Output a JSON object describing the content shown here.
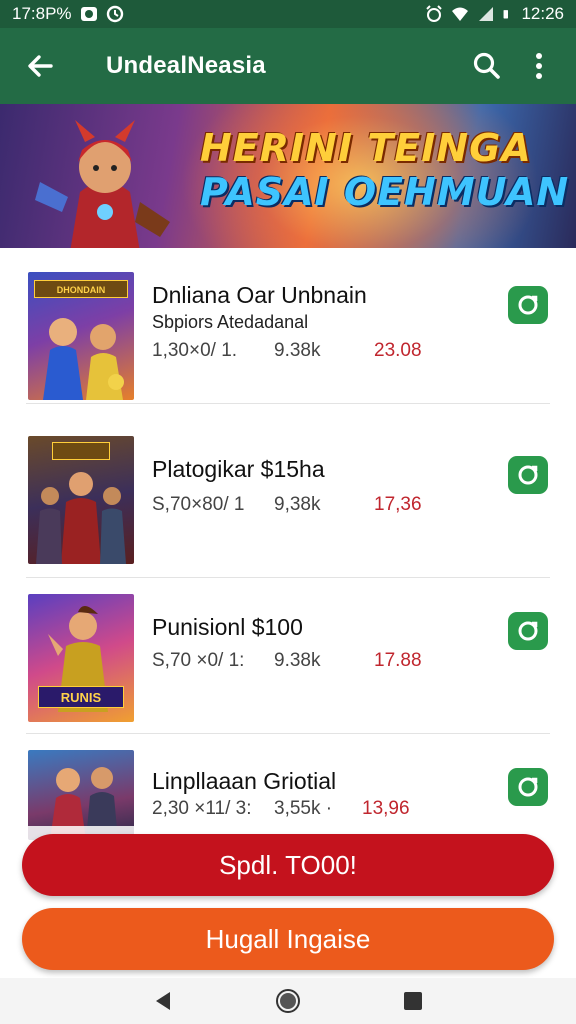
{
  "status_bar": {
    "time_left": "17:8P%",
    "time_right": "12:26",
    "icons": [
      "photo-icon",
      "clock-icon",
      "alarm-icon",
      "wifi-icon",
      "signal-icon",
      "battery-icon"
    ]
  },
  "app_bar": {
    "title": "UndealNeasia",
    "icons": [
      "arrow-back-icon",
      "search-icon",
      "more-vert-icon"
    ]
  },
  "banner": {
    "line1": "HERINI TEINGA",
    "line2": "PASAI OEHMUAN"
  },
  "list": {
    "items": [
      {
        "thumb_caption": "DHONDAIN",
        "name": "Dnliana Oar Unbnain",
        "subtitle": "Sbpiors Atedadanal",
        "stat1": "1,30×0/ 1.",
        "stat2": "9.38k",
        "price": "23.08",
        "action_icon": "camera-icon"
      },
      {
        "thumb_caption": "",
        "name": "Platogikar $15ha",
        "subtitle": "",
        "stat1": "S,70×80/ 1",
        "stat2": "9,38k",
        "price": "17,36",
        "action_icon": "camera-icon"
      },
      {
        "thumb_caption": "RUNIS",
        "name": "Punisionl $100",
        "subtitle": "",
        "stat1": "S,70 ×0/ 1:",
        "stat2": "9.38k",
        "price": "17.88",
        "action_icon": "camera-icon"
      },
      {
        "thumb_caption": "",
        "name": "Linpllaaan Griotial",
        "subtitle": "",
        "stat1": "2,30 ×11/ 3:",
        "stat2": "3,55k ·",
        "price": "13,96",
        "action_icon": "camera-icon"
      }
    ]
  },
  "buttons": {
    "primary": "Spdl. TO00!",
    "secondary": "Hugall Ingaise"
  },
  "colors": {
    "status_bar": "#1e5a3a",
    "app_bar": "#236b45",
    "primary_button": "#c4121d",
    "secondary_button": "#ec5a1c",
    "price": "#c0262e",
    "action": "#2a9a4c"
  },
  "nav": {
    "icons": [
      "nav-back-icon",
      "nav-home-icon",
      "nav-recents-icon"
    ]
  }
}
